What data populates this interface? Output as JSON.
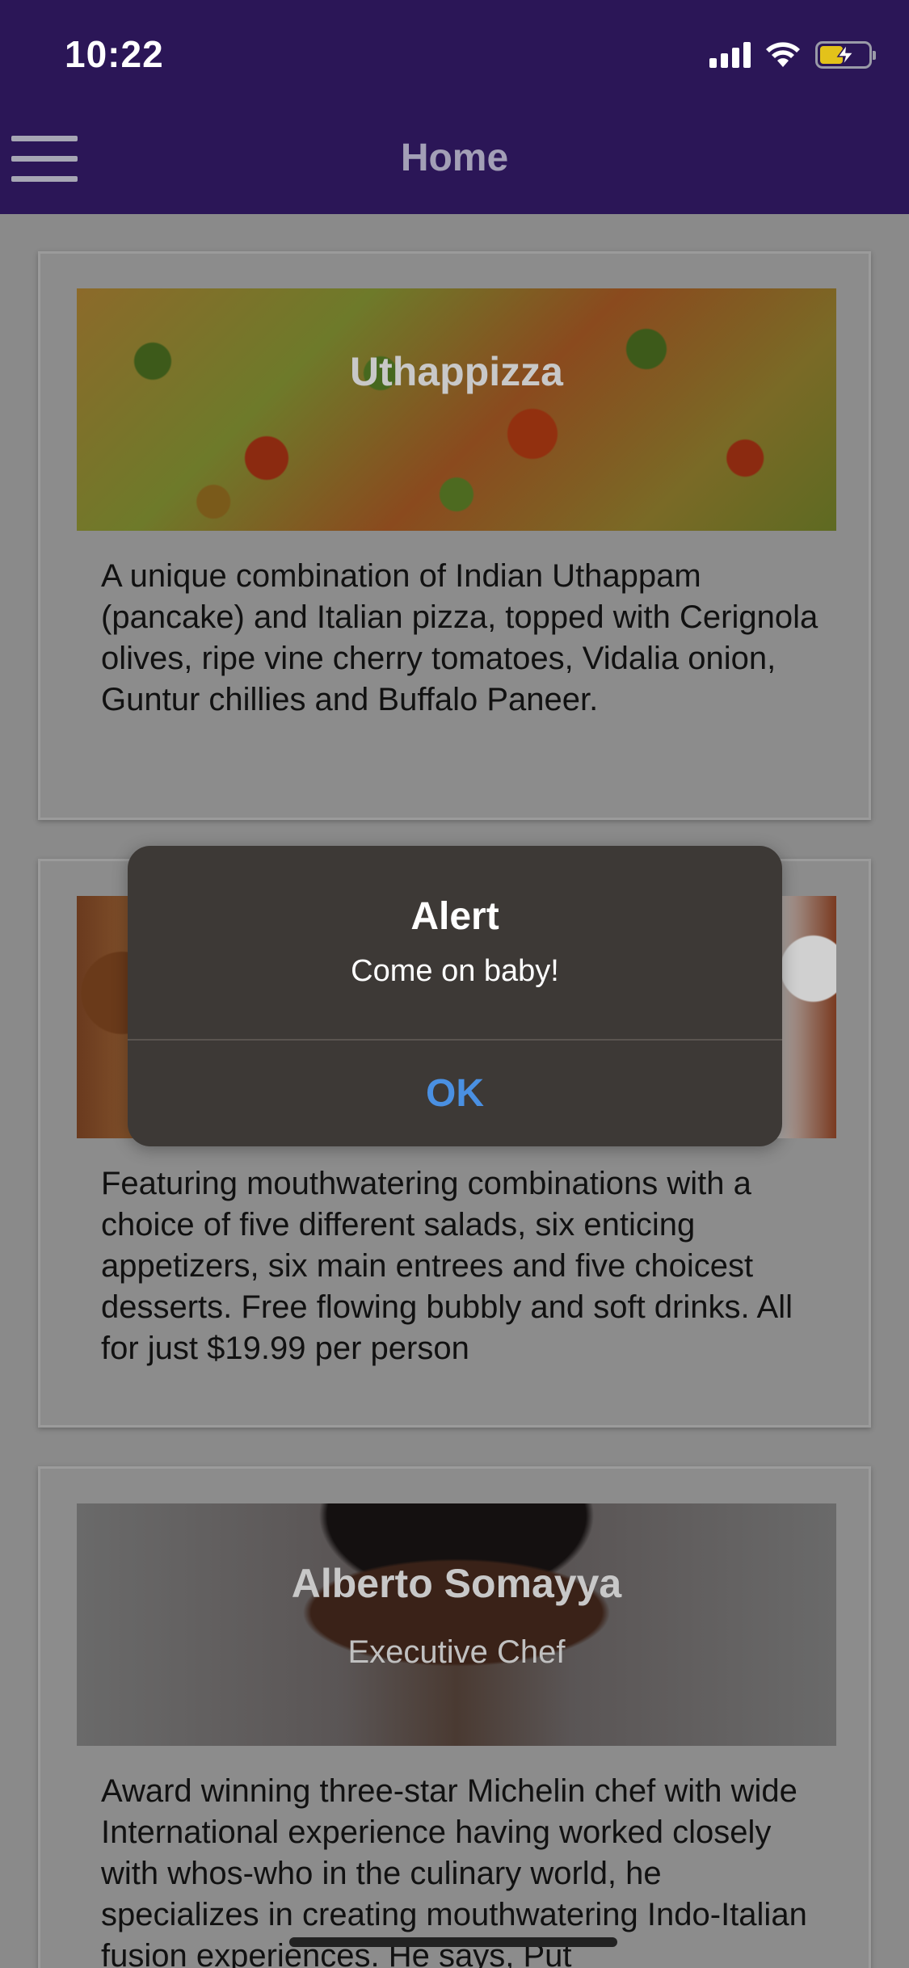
{
  "status_bar": {
    "time": "10:22"
  },
  "header": {
    "title": "Home"
  },
  "cards": [
    {
      "image_title": "Uthappizza",
      "image_subtitle": "",
      "description": "A unique combination of Indian Uthappam (pancake) and Italian pizza, topped with Cerignola olives, ripe vine cherry tomatoes, Vidalia onion, Guntur chillies and Buffalo Paneer."
    },
    {
      "image_title": "",
      "image_subtitle": "",
      "description": "Featuring mouthwatering combinations with a choice of five different salads, six enticing appetizers, six main entrees and five choicest desserts. Free flowing bubbly and soft drinks. All for just $19.99 per person"
    },
    {
      "image_title": "Alberto Somayya",
      "image_subtitle": "Executive Chef",
      "description": "Award winning three-star Michelin chef with wide International experience having worked closely with whos-who in the culinary world, he specializes in creating mouthwatering Indo-Italian fusion experiences. He says, Put"
    }
  ],
  "alert": {
    "title": "Alert",
    "message": "Come on baby!",
    "ok_label": "OK"
  },
  "colors": {
    "header_bg": "#2b1657",
    "alert_bg": "#3d3936",
    "alert_button": "#4a90e2"
  }
}
